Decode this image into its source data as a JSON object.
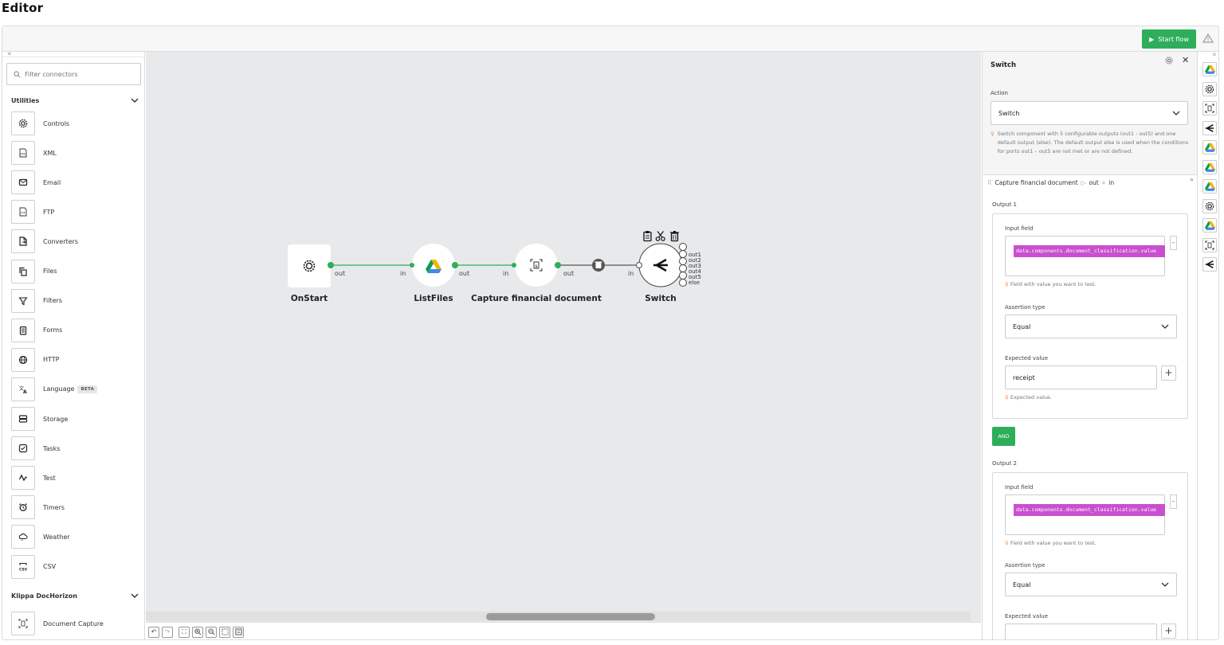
{
  "page": {
    "title": "Editor"
  },
  "toolbar": {
    "start_label": "Start flow"
  },
  "sidebar": {
    "filter_placeholder": "Filter connectors",
    "groups": [
      {
        "name": "Utilities"
      },
      {
        "name": "Klippa DocHorizon"
      }
    ],
    "utilities": [
      {
        "label": "Controls",
        "icon": "gear-icon"
      },
      {
        "label": "XML",
        "icon": "xml-file-icon"
      },
      {
        "label": "Email",
        "icon": "envelope-icon"
      },
      {
        "label": "FTP",
        "icon": "ftp-file-icon"
      },
      {
        "label": "Converters",
        "icon": "convert-file-icon"
      },
      {
        "label": "Files",
        "icon": "files-icon"
      },
      {
        "label": "Filters",
        "icon": "funnel-icon"
      },
      {
        "label": "Forms",
        "icon": "form-icon"
      },
      {
        "label": "HTTP",
        "icon": "globe-icon"
      },
      {
        "label": "Language",
        "icon": "translate-icon",
        "badge": "BETA"
      },
      {
        "label": "Storage",
        "icon": "storage-icon"
      },
      {
        "label": "Tasks",
        "icon": "tasks-icon"
      },
      {
        "label": "Test",
        "icon": "test-wave-icon"
      },
      {
        "label": "Timers",
        "icon": "alarm-clock-icon"
      },
      {
        "label": "Weather",
        "icon": "cloud-icon"
      },
      {
        "label": "CSV",
        "icon": "csv-icon"
      }
    ],
    "dochorizon": [
      {
        "label": "Document Capture",
        "icon": "document-scan-icon"
      }
    ]
  },
  "canvas": {
    "nodes": [
      {
        "label": "OnStart",
        "icon": "gear-icon"
      },
      {
        "label": "ListFiles",
        "icon": "google-drive-icon"
      },
      {
        "label": "Capture financial document",
        "icon": "document-scan-icon"
      },
      {
        "label": "Switch",
        "icon": "switch-split-icon"
      }
    ],
    "ports": {
      "out": "out",
      "in": "in"
    },
    "switch_outputs": [
      "out1",
      "out2",
      "out3",
      "out4",
      "out5",
      "else"
    ]
  },
  "panel": {
    "title": "Switch",
    "action_label": "Action",
    "action_value": "Switch",
    "action_hint": "Switch component with 5 configurable outputs (out1 - out5) and one default output (else). The default output else is used when the conditions for ports out1 – out5 are not met or are not defined.",
    "breadcrumb": {
      "source": "Capture financial document",
      "port_out": "out",
      "port_in": "in"
    },
    "outputs": [
      {
        "title": "Output 1",
        "input_field_label": "Input field",
        "input_value": "data.components.document_classification.value",
        "input_hint": "Field with value you want to test.",
        "assertion_label": "Assertion type",
        "assertion_value": "Equal",
        "expected_label": "Expected value",
        "expected_value": "receipt",
        "expected_hint": "Expected value."
      },
      {
        "title": "Output 2",
        "input_field_label": "Input field",
        "input_value": "data.components.document_classification.value",
        "input_hint": "Field with value you want to test.",
        "assertion_label": "Assertion type",
        "assertion_value": "Equal",
        "expected_label": "Expected value"
      }
    ],
    "and_label": "AND"
  },
  "colors": {
    "accent": "#2eae5a",
    "code_bg": "#c94fcf",
    "canvas_bg": "#e8e9eb"
  }
}
